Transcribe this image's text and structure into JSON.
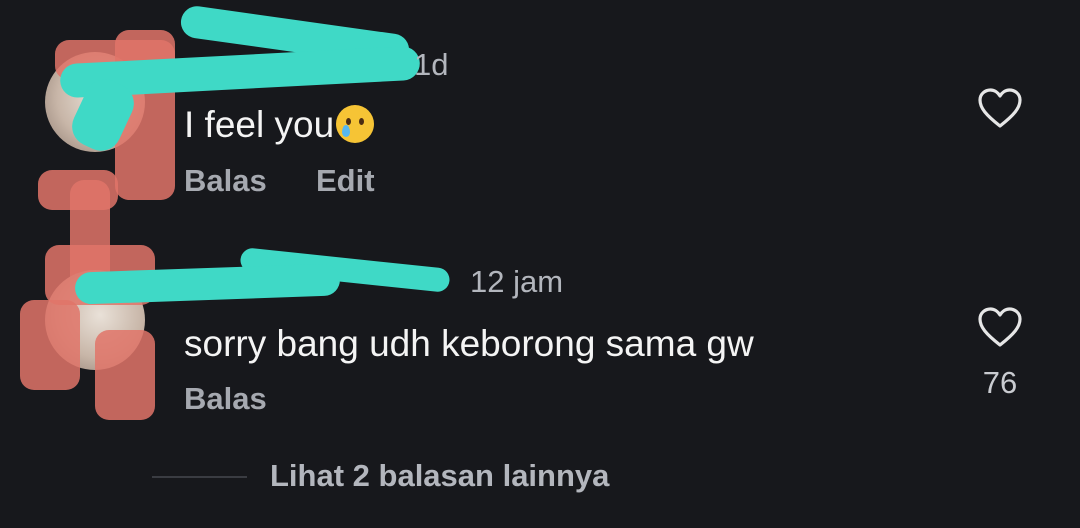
{
  "comments": [
    {
      "time": "1d",
      "text": "I feel you",
      "emoji": "crying-face-emoji",
      "actions": {
        "reply": "Balas",
        "edit": "Edit"
      }
    },
    {
      "time": "12 jam",
      "text": "sorry bang udh keborong sama gw",
      "actions": {
        "reply": "Balas"
      },
      "like_count": "76"
    }
  ],
  "view_more": "Lihat 2 balasan lainnya",
  "colors": {
    "background": "#17181c",
    "redaction_teal": "#3fd9c6",
    "redaction_pink": "#e07468"
  }
}
